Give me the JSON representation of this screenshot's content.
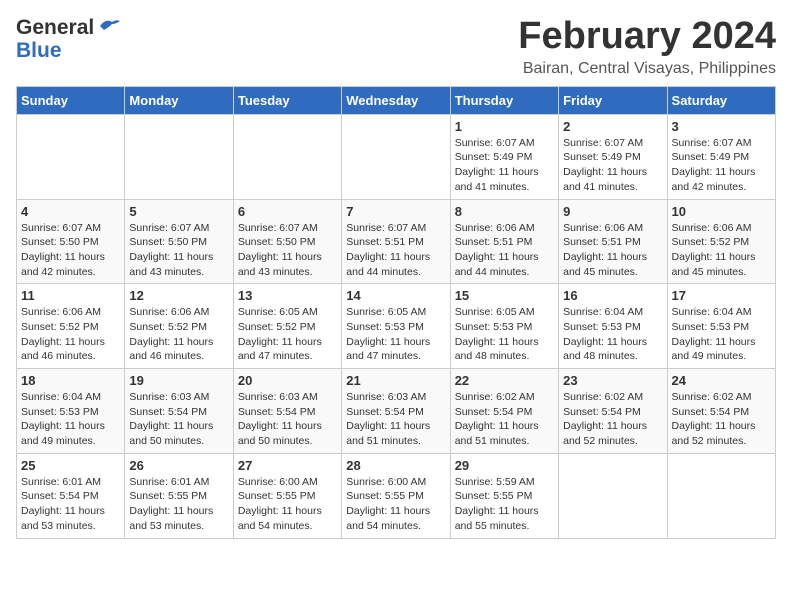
{
  "header": {
    "logo_general": "General",
    "logo_blue": "Blue",
    "month_title": "February 2024",
    "location": "Bairan, Central Visayas, Philippines"
  },
  "weekdays": [
    "Sunday",
    "Monday",
    "Tuesday",
    "Wednesday",
    "Thursday",
    "Friday",
    "Saturday"
  ],
  "weeks": [
    [
      {
        "day": "",
        "info": ""
      },
      {
        "day": "",
        "info": ""
      },
      {
        "day": "",
        "info": ""
      },
      {
        "day": "",
        "info": ""
      },
      {
        "day": "1",
        "info": "Sunrise: 6:07 AM\nSunset: 5:49 PM\nDaylight: 11 hours and 41 minutes."
      },
      {
        "day": "2",
        "info": "Sunrise: 6:07 AM\nSunset: 5:49 PM\nDaylight: 11 hours and 41 minutes."
      },
      {
        "day": "3",
        "info": "Sunrise: 6:07 AM\nSunset: 5:49 PM\nDaylight: 11 hours and 42 minutes."
      }
    ],
    [
      {
        "day": "4",
        "info": "Sunrise: 6:07 AM\nSunset: 5:50 PM\nDaylight: 11 hours and 42 minutes."
      },
      {
        "day": "5",
        "info": "Sunrise: 6:07 AM\nSunset: 5:50 PM\nDaylight: 11 hours and 43 minutes."
      },
      {
        "day": "6",
        "info": "Sunrise: 6:07 AM\nSunset: 5:50 PM\nDaylight: 11 hours and 43 minutes."
      },
      {
        "day": "7",
        "info": "Sunrise: 6:07 AM\nSunset: 5:51 PM\nDaylight: 11 hours and 44 minutes."
      },
      {
        "day": "8",
        "info": "Sunrise: 6:06 AM\nSunset: 5:51 PM\nDaylight: 11 hours and 44 minutes."
      },
      {
        "day": "9",
        "info": "Sunrise: 6:06 AM\nSunset: 5:51 PM\nDaylight: 11 hours and 45 minutes."
      },
      {
        "day": "10",
        "info": "Sunrise: 6:06 AM\nSunset: 5:52 PM\nDaylight: 11 hours and 45 minutes."
      }
    ],
    [
      {
        "day": "11",
        "info": "Sunrise: 6:06 AM\nSunset: 5:52 PM\nDaylight: 11 hours and 46 minutes."
      },
      {
        "day": "12",
        "info": "Sunrise: 6:06 AM\nSunset: 5:52 PM\nDaylight: 11 hours and 46 minutes."
      },
      {
        "day": "13",
        "info": "Sunrise: 6:05 AM\nSunset: 5:52 PM\nDaylight: 11 hours and 47 minutes."
      },
      {
        "day": "14",
        "info": "Sunrise: 6:05 AM\nSunset: 5:53 PM\nDaylight: 11 hours and 47 minutes."
      },
      {
        "day": "15",
        "info": "Sunrise: 6:05 AM\nSunset: 5:53 PM\nDaylight: 11 hours and 48 minutes."
      },
      {
        "day": "16",
        "info": "Sunrise: 6:04 AM\nSunset: 5:53 PM\nDaylight: 11 hours and 48 minutes."
      },
      {
        "day": "17",
        "info": "Sunrise: 6:04 AM\nSunset: 5:53 PM\nDaylight: 11 hours and 49 minutes."
      }
    ],
    [
      {
        "day": "18",
        "info": "Sunrise: 6:04 AM\nSunset: 5:53 PM\nDaylight: 11 hours and 49 minutes."
      },
      {
        "day": "19",
        "info": "Sunrise: 6:03 AM\nSunset: 5:54 PM\nDaylight: 11 hours and 50 minutes."
      },
      {
        "day": "20",
        "info": "Sunrise: 6:03 AM\nSunset: 5:54 PM\nDaylight: 11 hours and 50 minutes."
      },
      {
        "day": "21",
        "info": "Sunrise: 6:03 AM\nSunset: 5:54 PM\nDaylight: 11 hours and 51 minutes."
      },
      {
        "day": "22",
        "info": "Sunrise: 6:02 AM\nSunset: 5:54 PM\nDaylight: 11 hours and 51 minutes."
      },
      {
        "day": "23",
        "info": "Sunrise: 6:02 AM\nSunset: 5:54 PM\nDaylight: 11 hours and 52 minutes."
      },
      {
        "day": "24",
        "info": "Sunrise: 6:02 AM\nSunset: 5:54 PM\nDaylight: 11 hours and 52 minutes."
      }
    ],
    [
      {
        "day": "25",
        "info": "Sunrise: 6:01 AM\nSunset: 5:54 PM\nDaylight: 11 hours and 53 minutes."
      },
      {
        "day": "26",
        "info": "Sunrise: 6:01 AM\nSunset: 5:55 PM\nDaylight: 11 hours and 53 minutes."
      },
      {
        "day": "27",
        "info": "Sunrise: 6:00 AM\nSunset: 5:55 PM\nDaylight: 11 hours and 54 minutes."
      },
      {
        "day": "28",
        "info": "Sunrise: 6:00 AM\nSunset: 5:55 PM\nDaylight: 11 hours and 54 minutes."
      },
      {
        "day": "29",
        "info": "Sunrise: 5:59 AM\nSunset: 5:55 PM\nDaylight: 11 hours and 55 minutes."
      },
      {
        "day": "",
        "info": ""
      },
      {
        "day": "",
        "info": ""
      }
    ]
  ]
}
